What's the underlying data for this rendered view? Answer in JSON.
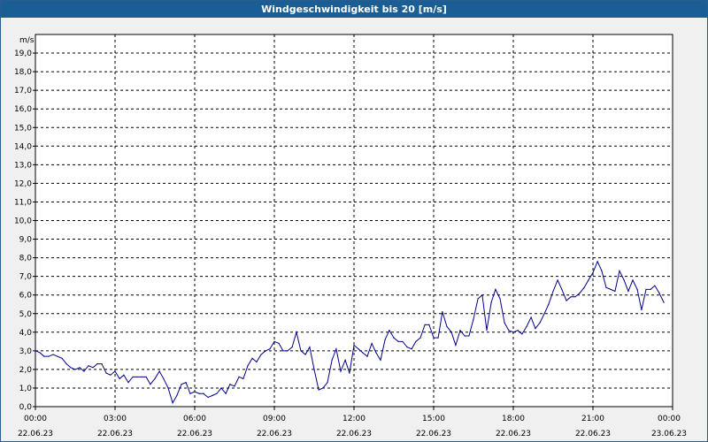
{
  "window": {
    "title": "Windgeschwindigkeit bis 20 [m/s]"
  },
  "chart_data": {
    "type": "line",
    "title": "Windgeschwindigkeit bis 20 [m/s]",
    "ylabel": "m/s",
    "xlabel": "",
    "ylim": [
      0,
      20
    ],
    "xlim_hours": [
      0,
      24
    ],
    "grid": true,
    "yticks": [
      "0,0",
      "1,0",
      "2,0",
      "3,0",
      "4,0",
      "5,0",
      "6,0",
      "7,0",
      "8,0",
      "9,0",
      "10,0",
      "11,0",
      "12,0",
      "13,0",
      "14,0",
      "15,0",
      "16,0",
      "17,0",
      "18,0",
      "19,0"
    ],
    "xticks": [
      {
        "hour": 0,
        "time": "00:00",
        "date": "22.06.23"
      },
      {
        "hour": 3,
        "time": "03:00",
        "date": "22.06.23"
      },
      {
        "hour": 6,
        "time": "06:00",
        "date": "22.06.23"
      },
      {
        "hour": 9,
        "time": "09:00",
        "date": "22.06.23"
      },
      {
        "hour": 12,
        "time": "12:00",
        "date": "22.06.23"
      },
      {
        "hour": 15,
        "time": "15:00",
        "date": "22.06.23"
      },
      {
        "hour": 18,
        "time": "18:00",
        "date": "22.06.23"
      },
      {
        "hour": 21,
        "time": "21:00",
        "date": "22.06.23"
      },
      {
        "hour": 24,
        "time": "00:00",
        "date": "23.06.23"
      }
    ],
    "line_color": "#00008b",
    "series": [
      {
        "x_hours": [
          0,
          0.17,
          0.33,
          0.5,
          0.67,
          0.83,
          1,
          1.17,
          1.33,
          1.5,
          1.67,
          1.83,
          2,
          2.17,
          2.33,
          2.5,
          2.67,
          2.83,
          3,
          3.17,
          3.33,
          3.5,
          3.67,
          3.83,
          4,
          4.17,
          4.33,
          4.5,
          4.67,
          4.83,
          5,
          5.17,
          5.33,
          5.5,
          5.67,
          5.83,
          6,
          6.17,
          6.33,
          6.5,
          6.67,
          6.83,
          7,
          7.17,
          7.33,
          7.5,
          7.67,
          7.83,
          8,
          8.17,
          8.33,
          8.5,
          8.67,
          8.83,
          9,
          9.17,
          9.33,
          9.5,
          9.67,
          9.83,
          10,
          10.17,
          10.33,
          10.5,
          10.67,
          10.83,
          11,
          11.17,
          11.33,
          11.5,
          11.67,
          11.83,
          12,
          12.17,
          12.33,
          12.5,
          12.67,
          12.83,
          13,
          13.17,
          13.33,
          13.5,
          13.67,
          13.83,
          14,
          14.17,
          14.33,
          14.5,
          14.67,
          14.83,
          15,
          15.17,
          15.33,
          15.5,
          15.67,
          15.83,
          16,
          16.17,
          16.33,
          16.5,
          16.67,
          16.83,
          17,
          17.17,
          17.33,
          17.5,
          17.67,
          17.83,
          18,
          18.17,
          18.33,
          18.5,
          18.67,
          18.83,
          19,
          19.17,
          19.33,
          19.5,
          19.67,
          19.83,
          20,
          20.17,
          20.33,
          20.5,
          20.67,
          20.83,
          21,
          21.17,
          21.33,
          21.5,
          21.67,
          21.83,
          22,
          22.17,
          22.33,
          22.5,
          22.67,
          22.83,
          23,
          23.17,
          23.33,
          23.5,
          23.67,
          23.83,
          24
        ],
        "values": [
          3.0,
          2.9,
          2.7,
          2.7,
          2.8,
          2.7,
          2.6,
          2.3,
          2.1,
          2.0,
          2.1,
          1.9,
          2.2,
          2.1,
          2.3,
          2.3,
          1.8,
          1.7,
          1.9,
          1.5,
          1.7,
          1.3,
          1.6,
          1.6,
          1.6,
          1.6,
          1.2,
          1.5,
          1.9,
          1.5,
          1.0,
          0.2,
          0.6,
          1.2,
          1.3,
          0.7,
          0.8,
          0.7,
          0.7,
          0.5,
          0.6,
          0.7,
          1.0,
          0.7,
          1.2,
          1.1,
          1.6,
          1.5,
          2.2,
          2.6,
          2.4,
          2.8,
          3.0,
          3.1,
          3.5,
          3.4,
          3.0,
          3.0,
          3.2,
          4.0,
          3.0,
          2.8,
          3.2,
          2.0,
          0.9,
          1.0,
          1.3,
          2.5,
          3.1,
          1.9,
          2.5,
          1.8,
          3.3,
          3.1,
          2.9,
          2.7,
          3.4,
          2.9,
          2.5,
          3.6,
          4.1,
          3.7,
          3.5,
          3.5,
          3.2,
          3.1,
          3.5,
          3.7,
          4.4,
          4.4,
          3.7,
          3.7,
          5.1,
          4.3,
          4.0,
          3.3,
          4.1,
          3.8,
          3.8,
          4.7,
          5.8,
          6.0,
          4.1,
          5.6,
          6.3,
          5.8,
          4.5,
          4.1,
          4.0,
          4.1,
          3.9,
          4.3,
          4.8,
          4.2,
          4.5,
          5.0,
          5.5,
          6.2,
          6.8,
          6.3,
          5.7,
          5.9,
          5.9,
          6.1,
          6.4,
          6.8,
          7.2,
          7.8,
          7.3,
          6.4,
          6.3,
          6.2,
          7.3,
          6.8,
          6.2,
          6.8,
          6.3,
          5.2,
          6.3,
          6.3,
          6.5,
          6.1,
          5.6
        ]
      }
    ]
  }
}
